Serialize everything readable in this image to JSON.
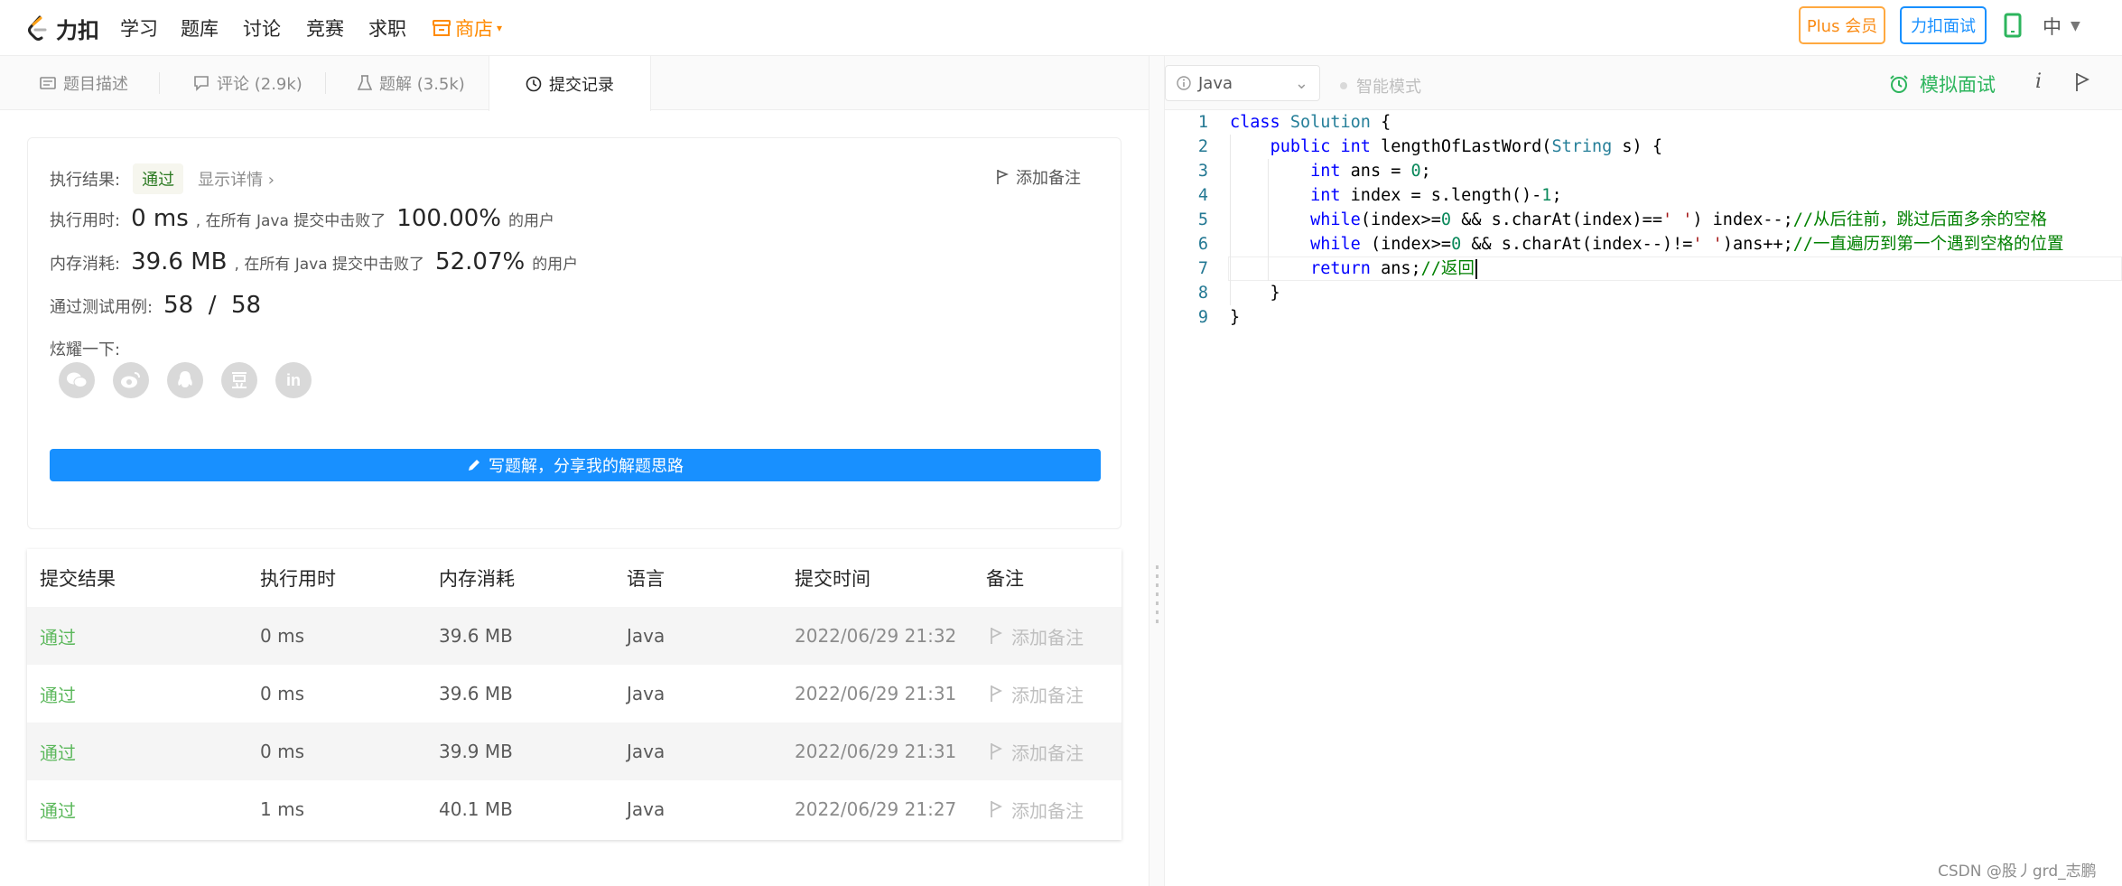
{
  "navbar": {
    "logo_text": "力扣",
    "items": [
      "学习",
      "题库",
      "讨论",
      "竞赛",
      "求职"
    ],
    "store_label": "商店",
    "plus_button": "Plus 会员",
    "interview_button": "力扣面试",
    "lang_switch": "中"
  },
  "tabs": {
    "description": "题目描述",
    "comments": "评论 (2.9k)",
    "solutions": "题解 (3.5k)",
    "submissions": "提交记录"
  },
  "result": {
    "exec_result_label": "执行结果:",
    "status": "通过",
    "show_detail": "显示详情 ›",
    "add_note": "添加备注",
    "runtime_label": "执行用时:",
    "runtime_value": "0 ms",
    "runtime_beat_text": ", 在所有 Java 提交中击败了",
    "runtime_percent": "100.00%",
    "runtime_suffix": "的用户",
    "memory_label": "内存消耗:",
    "memory_value": "39.6 MB",
    "memory_beat_text": ", 在所有 Java 提交中击败了",
    "memory_percent": "52.07%",
    "memory_suffix": "的用户",
    "tests_label": "通过测试用例:",
    "tests_value": "58  /  58",
    "share_label": "炫耀一下:",
    "share_icons": [
      "wechat-icon",
      "weibo-icon",
      "qq-icon",
      "douban-icon",
      "linkedin-icon"
    ],
    "write_solution": "写题解，分享我的解题思路"
  },
  "submissions": {
    "headers": [
      "提交结果",
      "执行用时",
      "内存消耗",
      "语言",
      "提交时间",
      "备注"
    ],
    "rows": [
      {
        "status": "通过",
        "runtime": "0 ms",
        "memory": "39.6 MB",
        "lang": "Java",
        "time": "2022/06/29 21:32",
        "note": "添加备注"
      },
      {
        "status": "通过",
        "runtime": "0 ms",
        "memory": "39.6 MB",
        "lang": "Java",
        "time": "2022/06/29 21:31",
        "note": "添加备注"
      },
      {
        "status": "通过",
        "runtime": "0 ms",
        "memory": "39.9 MB",
        "lang": "Java",
        "time": "2022/06/29 21:31",
        "note": "添加备注"
      },
      {
        "status": "通过",
        "runtime": "1 ms",
        "memory": "40.1 MB",
        "lang": "Java",
        "time": "2022/06/29 21:27",
        "note": "添加备注"
      }
    ]
  },
  "editor_toolbar": {
    "language": "Java",
    "smart_mode": "智能模式",
    "mock_interview": "模拟面试",
    "info": "i"
  },
  "code": {
    "line_numbers": [
      "1",
      "2",
      "3",
      "4",
      "5",
      "6",
      "7",
      "8",
      "9"
    ],
    "lines": [
      "class Solution {",
      "    public int lengthOfLastWord(String s) {",
      "        int ans = 0;",
      "        int index = s.length()-1;",
      "        while(index>=0 && s.charAt(index)==' ') index--;//从后往前，跳过后面多余的空格",
      "        while (index>=0 && s.charAt(index--)!=' ')ans++;//一直遍历到第一个遇到空格的位置",
      "        return ans;//返回",
      "    }",
      "}"
    ]
  },
  "watermark": "CSDN @股丿grd_志鹏"
}
